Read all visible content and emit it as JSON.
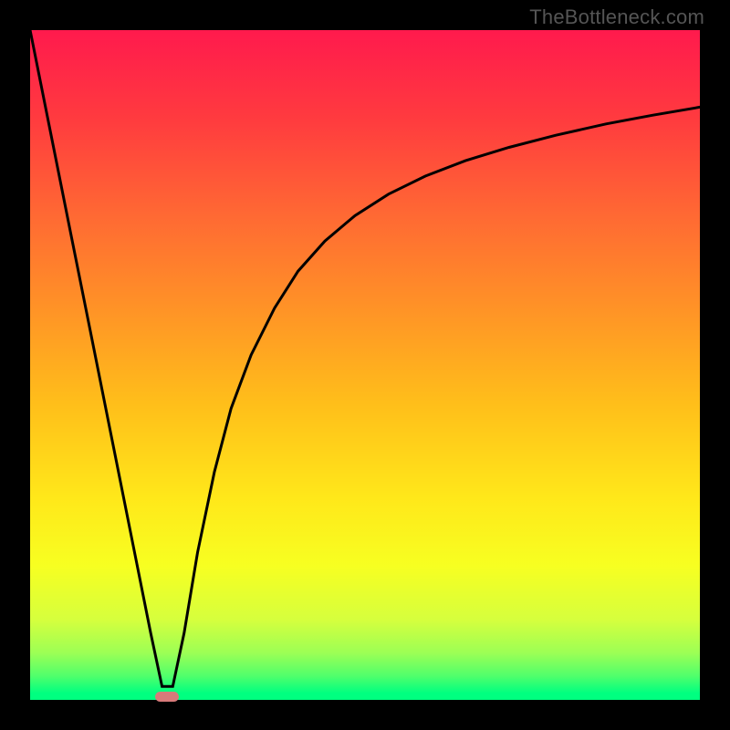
{
  "watermark": "TheBottleneck.com",
  "chart_data": {
    "type": "line",
    "title": "",
    "xlabel": "",
    "ylabel": "",
    "xlim": [
      0,
      100
    ],
    "ylim": [
      0,
      100
    ],
    "gradient_direction": "vertical",
    "gradient_stops": [
      {
        "pos": 0,
        "color": "#ff1a4d"
      },
      {
        "pos": 13,
        "color": "#ff3a3f"
      },
      {
        "pos": 28,
        "color": "#ff6a33"
      },
      {
        "pos": 42,
        "color": "#ff9426"
      },
      {
        "pos": 56,
        "color": "#ffbf1a"
      },
      {
        "pos": 70,
        "color": "#ffe81a"
      },
      {
        "pos": 80,
        "color": "#f7ff21"
      },
      {
        "pos": 88,
        "color": "#d6ff3d"
      },
      {
        "pos": 93,
        "color": "#9cff55"
      },
      {
        "pos": 96.5,
        "color": "#4eff6c"
      },
      {
        "pos": 99,
        "color": "#00ff80"
      },
      {
        "pos": 100,
        "color": "#00ff80"
      }
    ],
    "series": [
      {
        "name": "bottleneck-curve",
        "x": [
          0.0,
          3.0,
          6.0,
          9.0,
          12.0,
          15.0,
          18.0,
          19.7,
          21.3,
          23.0,
          25.0,
          27.5,
          30.0,
          33.0,
          36.5,
          40.0,
          44.0,
          48.5,
          53.5,
          59.0,
          65.0,
          71.5,
          78.5,
          86.0,
          93.0,
          100.0
        ],
        "y": [
          100.0,
          85.0,
          70.0,
          55.0,
          40.0,
          25.0,
          10.0,
          2.0,
          2.0,
          10.0,
          22.0,
          34.0,
          43.5,
          51.5,
          58.5,
          64.0,
          68.5,
          72.3,
          75.5,
          78.2,
          80.5,
          82.5,
          84.3,
          86.0,
          87.3,
          88.5
        ]
      }
    ],
    "marker": {
      "x": 20.5,
      "y": 0.5,
      "color": "#d87a7a"
    }
  }
}
